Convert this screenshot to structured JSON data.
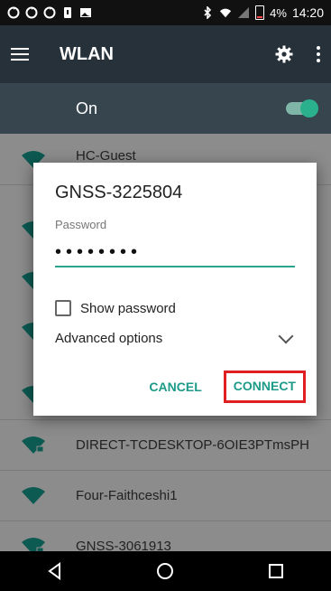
{
  "status": {
    "battery": "4%",
    "time": "14:20",
    "icons": [
      "sync-icon",
      "sync-icon",
      "sync-icon",
      "sim-icon",
      "gallery-icon",
      "bluetooth-icon",
      "wifi-icon",
      "signal-icon",
      "battery-icon"
    ]
  },
  "appbar": {
    "title": "WLAN",
    "icons": [
      "menu-icon",
      "settings-icon",
      "more-icon"
    ]
  },
  "toggle": {
    "label": "On",
    "state": "on"
  },
  "list": {
    "items": [
      {
        "label": "HC-Guest"
      },
      {
        "label": "DIRECT-TCDESKTOP-6OIE3PTmsPH"
      },
      {
        "label": "Four-Faithceshi1"
      },
      {
        "label": "GNSS-3061913"
      }
    ]
  },
  "dialog": {
    "title": "GNSS-3225804",
    "password_label": "Password",
    "password_value": "••••••••",
    "show_password": "Show password",
    "advanced": "Advanced options",
    "cancel": "CANCEL",
    "connect": "CONNECT"
  },
  "colors": {
    "accent": "#2aa48d",
    "highlight": "#e02020",
    "appbar": "#26313a",
    "onbar": "#37454f"
  }
}
